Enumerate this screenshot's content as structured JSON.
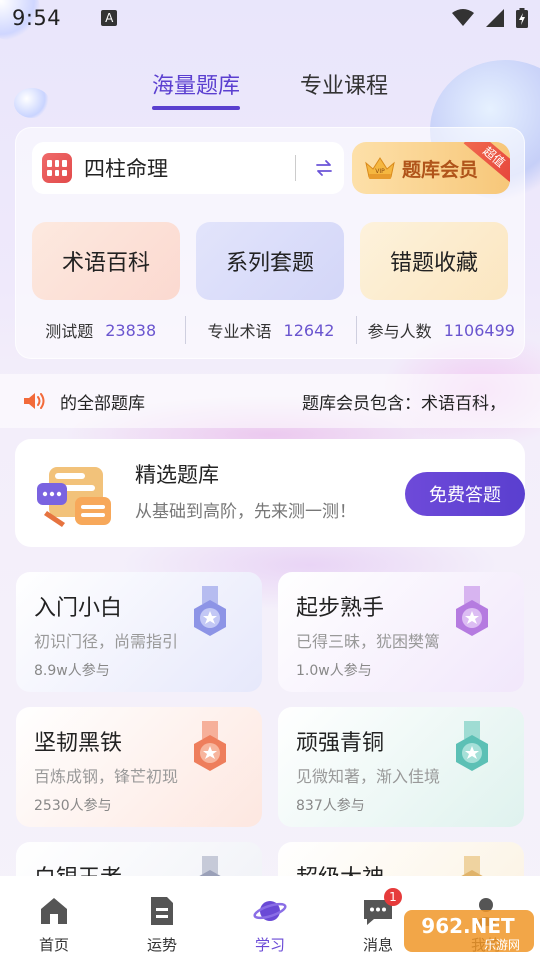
{
  "status_bar": {
    "time": "9:54",
    "notif_glyph": "A"
  },
  "top_tabs": [
    {
      "label": "海量题库",
      "active": true
    },
    {
      "label": "专业课程",
      "active": false
    }
  ],
  "subject": {
    "name": "四柱命理",
    "icon": "calendar-grid-icon",
    "swap_icon": "swap-arrows-icon"
  },
  "vip": {
    "label": "题库会员",
    "ribbon": "超值",
    "icon": "vip-crown-icon"
  },
  "features": [
    "术语百科",
    "系列套题",
    "错题收藏"
  ],
  "stats": [
    {
      "label": "测试题",
      "value": "23838"
    },
    {
      "label": "专业术语",
      "value": "12642"
    },
    {
      "label": "参与人数",
      "value": "1106499"
    }
  ],
  "notice": {
    "text_left": "的全部题库",
    "text_right": "题库会员包含：术语百科，"
  },
  "featured": {
    "title": "精选题库",
    "subtitle": "从基础到高阶，先来测一测！",
    "button": "免费答题"
  },
  "levels": [
    {
      "title": "入门小白",
      "desc": "初识门径，尚需指引",
      "count": "8.9w人参与",
      "color": "#8d94e6"
    },
    {
      "title": "起步熟手",
      "desc": "已得三昧，犹困樊篱",
      "count": "1.0w人参与",
      "color": "#b57be0"
    },
    {
      "title": "坚韧黑铁",
      "desc": "百炼成钢，锋芒初现",
      "count": "2530人参与",
      "color": "#ee7e5c"
    },
    {
      "title": "顽强青铜",
      "desc": "见微知著，渐入佳境",
      "count": "837人参与",
      "color": "#5cc0b5"
    },
    {
      "title": "白银王者",
      "desc": "",
      "count": "",
      "color": "#9aa0b8"
    },
    {
      "title": "超级大神",
      "desc": "",
      "count": "",
      "color": "#e0b36a"
    }
  ],
  "bottom_nav": [
    {
      "label": "首页",
      "icon": "home-icon",
      "active": false
    },
    {
      "label": "运势",
      "icon": "document-icon",
      "active": false
    },
    {
      "label": "学习",
      "icon": "planet-icon",
      "active": true
    },
    {
      "label": "消息",
      "icon": "chat-icon",
      "active": false,
      "badge": "1"
    },
    {
      "label": "我的",
      "icon": "profile-icon",
      "active": false
    }
  ],
  "watermark": {
    "text": "962.NET",
    "subtext": "乐游网"
  }
}
